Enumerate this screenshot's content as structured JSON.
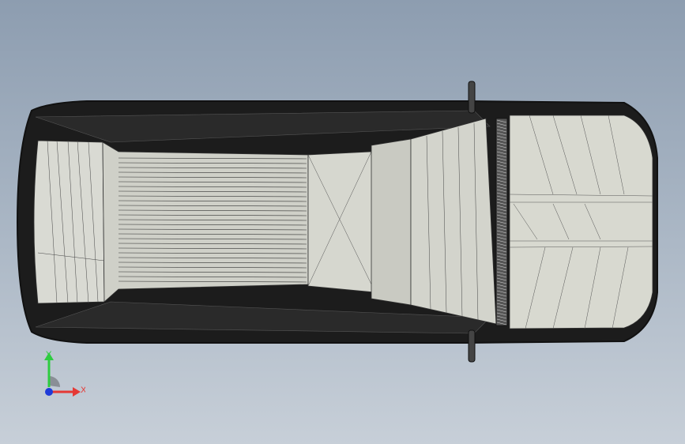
{
  "viewport": {
    "background_top": "#8d9db0",
    "background_bottom": "#c7cfd8",
    "model": "car-top-view-wireframe"
  },
  "triad": {
    "y_label": "Y",
    "x_label": "X",
    "y_color": "#2ecc40",
    "x_color": "#e53935",
    "z_color": "#1f3bd8"
  }
}
